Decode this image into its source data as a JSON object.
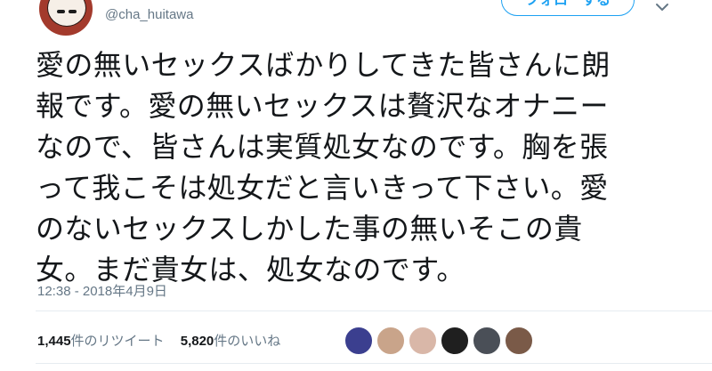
{
  "user": {
    "handle": "@cha_huitawa",
    "follow_label": "フォローする"
  },
  "tweet": {
    "lines": [
      "愛の無いセックスばかりしてきた皆さんに朗",
      "報です。愛の無いセックスは贅沢なオナニー",
      "なので、皆さんは実質処女なのです。胸を張",
      "って我こそは処女だと言いきって下さい。愛",
      "のないセックスしかした事の無いそこの貴",
      "女。まだ貴女は、処女なのです。"
    ],
    "timestamp": "12:38 - 2018年4月9日"
  },
  "stats": {
    "retweet_count": "1,445",
    "retweet_label": "件のリツイート",
    "like_count": "5,820",
    "like_label": "件のいいね"
  },
  "likers": [
    {
      "icon": "liker-avatar-1",
      "color": "#3b3f8f"
    },
    {
      "icon": "liker-avatar-2",
      "color": "#c9a48a"
    },
    {
      "icon": "liker-avatar-3",
      "color": "#d9b7a8"
    },
    {
      "icon": "liker-avatar-4",
      "color": "#1f1f1f"
    },
    {
      "icon": "liker-avatar-5",
      "color": "#4a4f57"
    },
    {
      "icon": "liker-avatar-6",
      "color": "#7a5a48"
    }
  ],
  "colors": {
    "accent": "#1da1f2",
    "muted": "#657786",
    "text": "#14171a"
  }
}
